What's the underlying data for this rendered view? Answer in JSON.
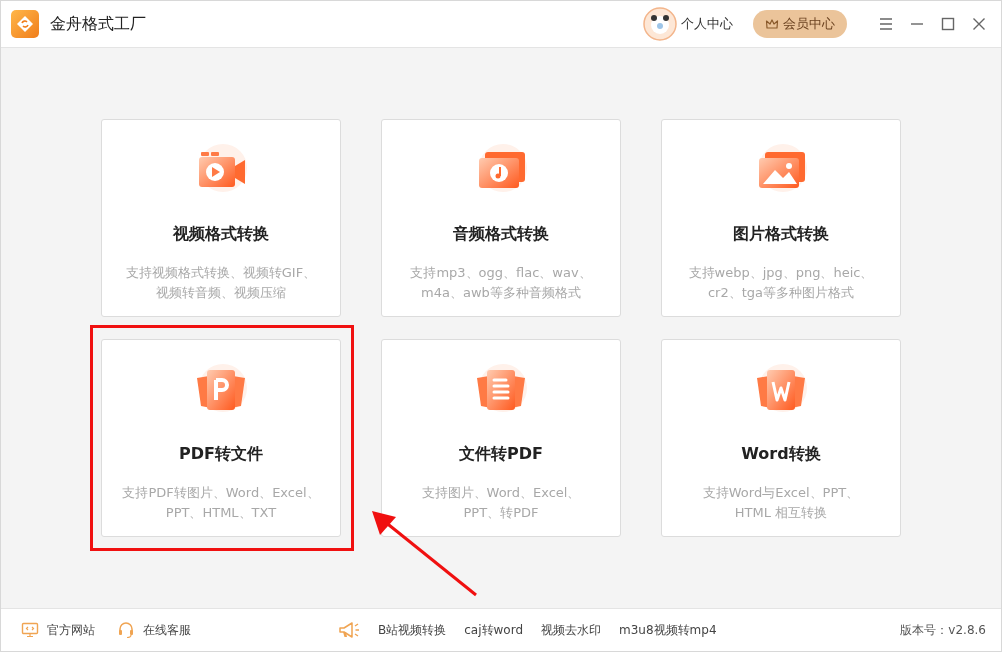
{
  "window": {
    "title": "金舟格式工厂"
  },
  "header": {
    "user_link": "个人中心",
    "vip_button": "会员中心"
  },
  "cards": [
    {
      "kind": "video",
      "title": "视频格式转换",
      "description": [
        "支持视频格式转换、视频转GIF、",
        "视频转音频、视频压缩"
      ],
      "highlighted": false
    },
    {
      "kind": "audio",
      "title": "音频格式转换",
      "description": [
        "支持mp3、ogg、flac、wav、",
        "m4a、awb等多种音频格式"
      ],
      "highlighted": false
    },
    {
      "kind": "image",
      "title": "图片格式转换",
      "description": [
        "支持webp、jpg、png、heic、",
        "cr2、tga等多种图片格式"
      ],
      "highlighted": false
    },
    {
      "kind": "pdf",
      "title": "PDF转文件",
      "description": [
        "支持PDF转图片、Word、Excel、",
        "PPT、HTML、TXT"
      ],
      "highlighted": true
    },
    {
      "kind": "doc",
      "title": "文件转PDF",
      "description": [
        "支持图片、Word、Excel、",
        "PPT、转PDF"
      ],
      "highlighted": false
    },
    {
      "kind": "word",
      "title": "Word转换",
      "description": [
        "支持Word与Excel、PPT、",
        "HTML 相互转换"
      ],
      "highlighted": false
    }
  ],
  "footer": {
    "left_links": [
      {
        "kind": "website",
        "label": "官方网站"
      },
      {
        "kind": "support",
        "label": "在线客服"
      }
    ],
    "quick_links": [
      "B站视频转换",
      "caj转word",
      "视频去水印",
      "m3u8视频转mp4"
    ],
    "version": "版本号：v2.8.6"
  }
}
